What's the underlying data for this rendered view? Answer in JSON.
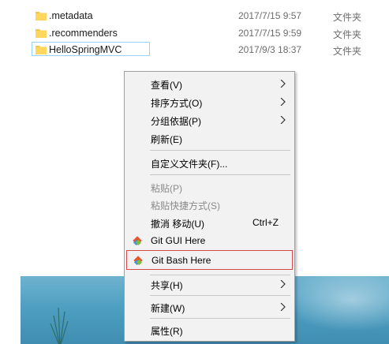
{
  "files": [
    {
      "name": ".metadata",
      "date": "2017/7/15 9:57",
      "type": "文件夹",
      "selected": false
    },
    {
      "name": ".recommenders",
      "date": "2017/7/15 9:59",
      "type": "文件夹",
      "selected": false
    },
    {
      "name": "HelloSpringMVC",
      "date": "2017/9/3 18:37",
      "type": "文件夹",
      "selected": true
    }
  ],
  "menu": {
    "view": "查看(V)",
    "sort": "排序方式(O)",
    "group": "分组依据(P)",
    "refresh": "刷新(E)",
    "customize": "自定义文件夹(F)...",
    "paste": "粘贴(P)",
    "paste_shortcut": "粘贴快捷方式(S)",
    "undo_move": "撤消 移动(U)",
    "undo_shortcut": "Ctrl+Z",
    "git_gui": "Git GUI Here",
    "git_bash": "Git Bash Here",
    "share": "共享(H)",
    "new": "新建(W)",
    "properties": "属性(R)"
  },
  "colors": {
    "folder": "#f5c542",
    "highlight_border": "#d44a4a",
    "selection_border": "#99d1ff"
  }
}
